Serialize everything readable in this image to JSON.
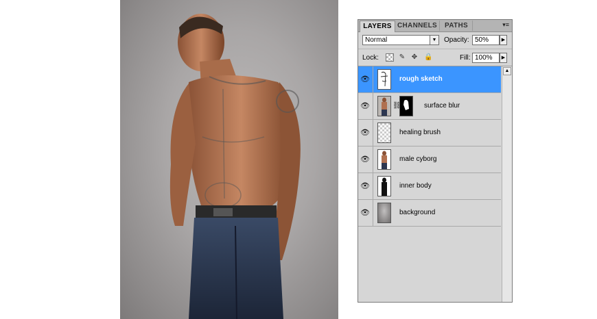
{
  "panel": {
    "tabs": [
      {
        "label": "LAYERS",
        "active": true
      },
      {
        "label": "CHANNELS",
        "active": false
      },
      {
        "label": "PATHS",
        "active": false
      }
    ],
    "menu_glyph": "▾≡",
    "blend_mode": "Normal",
    "opacity_label": "Opacity:",
    "opacity_value": "50%",
    "lock_label": "Lock:",
    "fill_label": "Fill:",
    "fill_value": "100%",
    "layers": [
      {
        "name": "rough sketch",
        "visible": true,
        "selected": true,
        "thumb": "sketch-thumbnail",
        "mask": false
      },
      {
        "name": "surface blur",
        "visible": true,
        "selected": false,
        "thumb": "figure-thumbnail",
        "mask": true
      },
      {
        "name": "healing brush",
        "visible": true,
        "selected": false,
        "thumb": "transparent-thumbnail",
        "mask": false
      },
      {
        "name": "male cyborg",
        "visible": true,
        "selected": false,
        "thumb": "figure-thumbnail",
        "mask": false
      },
      {
        "name": "inner body",
        "visible": true,
        "selected": false,
        "thumb": "silhouette-thumbnail",
        "mask": false
      },
      {
        "name": "background",
        "visible": true,
        "selected": false,
        "thumb": "gradient-thumbnail",
        "mask": false
      }
    ]
  },
  "colors": {
    "selection": "#3b95ff",
    "panel_bg": "#d6d6d6"
  }
}
